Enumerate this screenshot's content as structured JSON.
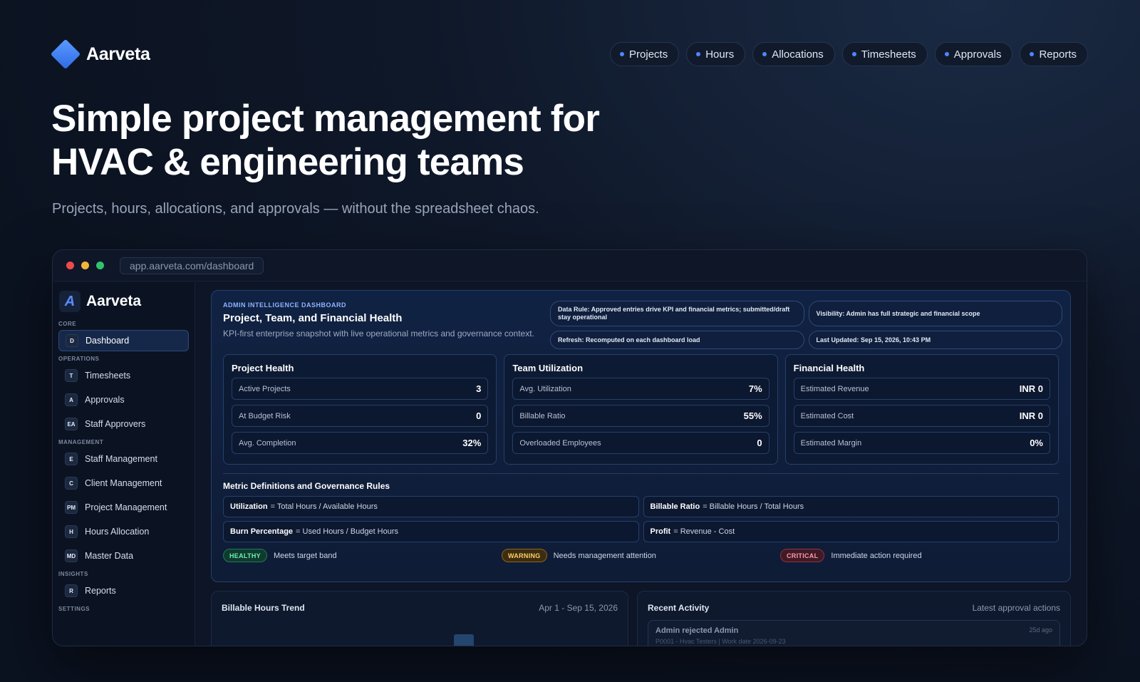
{
  "site": {
    "brand": "Aarveta",
    "nav": [
      "Projects",
      "Hours",
      "Allocations",
      "Timesheets",
      "Approvals",
      "Reports"
    ],
    "hero_title": "Simple project management for HVAC & engineering teams",
    "hero_subtitle": "Projects, hours, allocations, and approvals — without the spreadsheet chaos."
  },
  "browser": {
    "url": "app.aarveta.com/dashboard",
    "colors": {
      "close": "#ef4a4a",
      "minimize": "#f4b43a",
      "zoom": "#2fc46a"
    }
  },
  "sidebar": {
    "brand": "Aarveta",
    "sections": [
      {
        "label": "CORE",
        "items": [
          {
            "badge": "D",
            "label": "Dashboard",
            "active": true
          }
        ]
      },
      {
        "label": "OPERATIONS",
        "items": [
          {
            "badge": "T",
            "label": "Timesheets"
          },
          {
            "badge": "A",
            "label": "Approvals"
          },
          {
            "badge": "EA",
            "label": "Staff Approvers"
          }
        ]
      },
      {
        "label": "MANAGEMENT",
        "items": [
          {
            "badge": "E",
            "label": "Staff Management"
          },
          {
            "badge": "C",
            "label": "Client Management"
          },
          {
            "badge": "PM",
            "label": "Project Management"
          },
          {
            "badge": "H",
            "label": "Hours Allocation"
          },
          {
            "badge": "MD",
            "label": "Master Data"
          }
        ]
      },
      {
        "label": "INSIGHTS",
        "items": [
          {
            "badge": "R",
            "label": "Reports"
          }
        ]
      },
      {
        "label": "SETTINGS",
        "items": []
      }
    ]
  },
  "dashboard": {
    "eyebrow": "ADMIN INTELLIGENCE DASHBOARD",
    "title": "Project, Team, and Financial Health",
    "description": "KPI-first enterprise snapshot with live operational metrics and governance context.",
    "chips": [
      "Data Rule: Approved entries drive KPI and financial metrics; submitted/draft stay operational",
      "Visibility: Admin has full strategic and financial scope",
      "Refresh: Recomputed on each dashboard load",
      "Last Updated: Sep 15, 2026, 10:43 PM"
    ],
    "cards": [
      {
        "title": "Project Health",
        "metrics": [
          {
            "label": "Active Projects",
            "value": "3"
          },
          {
            "label": "At Budget Risk",
            "value": "0"
          },
          {
            "label": "Avg. Completion",
            "value": "32%"
          }
        ]
      },
      {
        "title": "Team Utilization",
        "metrics": [
          {
            "label": "Avg. Utilization",
            "value": "7%"
          },
          {
            "label": "Billable Ratio",
            "value": "55%"
          },
          {
            "label": "Overloaded Employees",
            "value": "0"
          }
        ]
      },
      {
        "title": "Financial Health",
        "metrics": [
          {
            "label": "Estimated Revenue",
            "value": "INR 0"
          },
          {
            "label": "Estimated Cost",
            "value": "INR 0"
          },
          {
            "label": "Estimated Margin",
            "value": "0%"
          }
        ]
      }
    ],
    "definitions_title": "Metric Definitions and Governance Rules",
    "definitions": [
      {
        "term": "Utilization",
        "formula": "= Total Hours / Available Hours"
      },
      {
        "term": "Billable Ratio",
        "formula": "= Billable Hours / Total Hours"
      },
      {
        "term": "Burn Percentage",
        "formula": "= Used Hours / Budget Hours"
      },
      {
        "term": "Profit",
        "formula": "= Revenue - Cost"
      }
    ],
    "legend": [
      {
        "tag": "HEALTHY",
        "text": "Meets target band"
      },
      {
        "tag": "WARNING",
        "text": "Needs management attention"
      },
      {
        "tag": "CRITICAL",
        "text": "Immediate action required"
      }
    ],
    "trend": {
      "title": "Billable Hours Trend",
      "range": "Apr 1 - Sep 15, 2026"
    },
    "activity": {
      "title": "Recent Activity",
      "subtitle": "Latest approval actions",
      "item": {
        "title": "Admin rejected Admin",
        "meta": "P0001 - Hvac Testers | Work date 2026-09-23",
        "time": "25d ago"
      }
    }
  }
}
